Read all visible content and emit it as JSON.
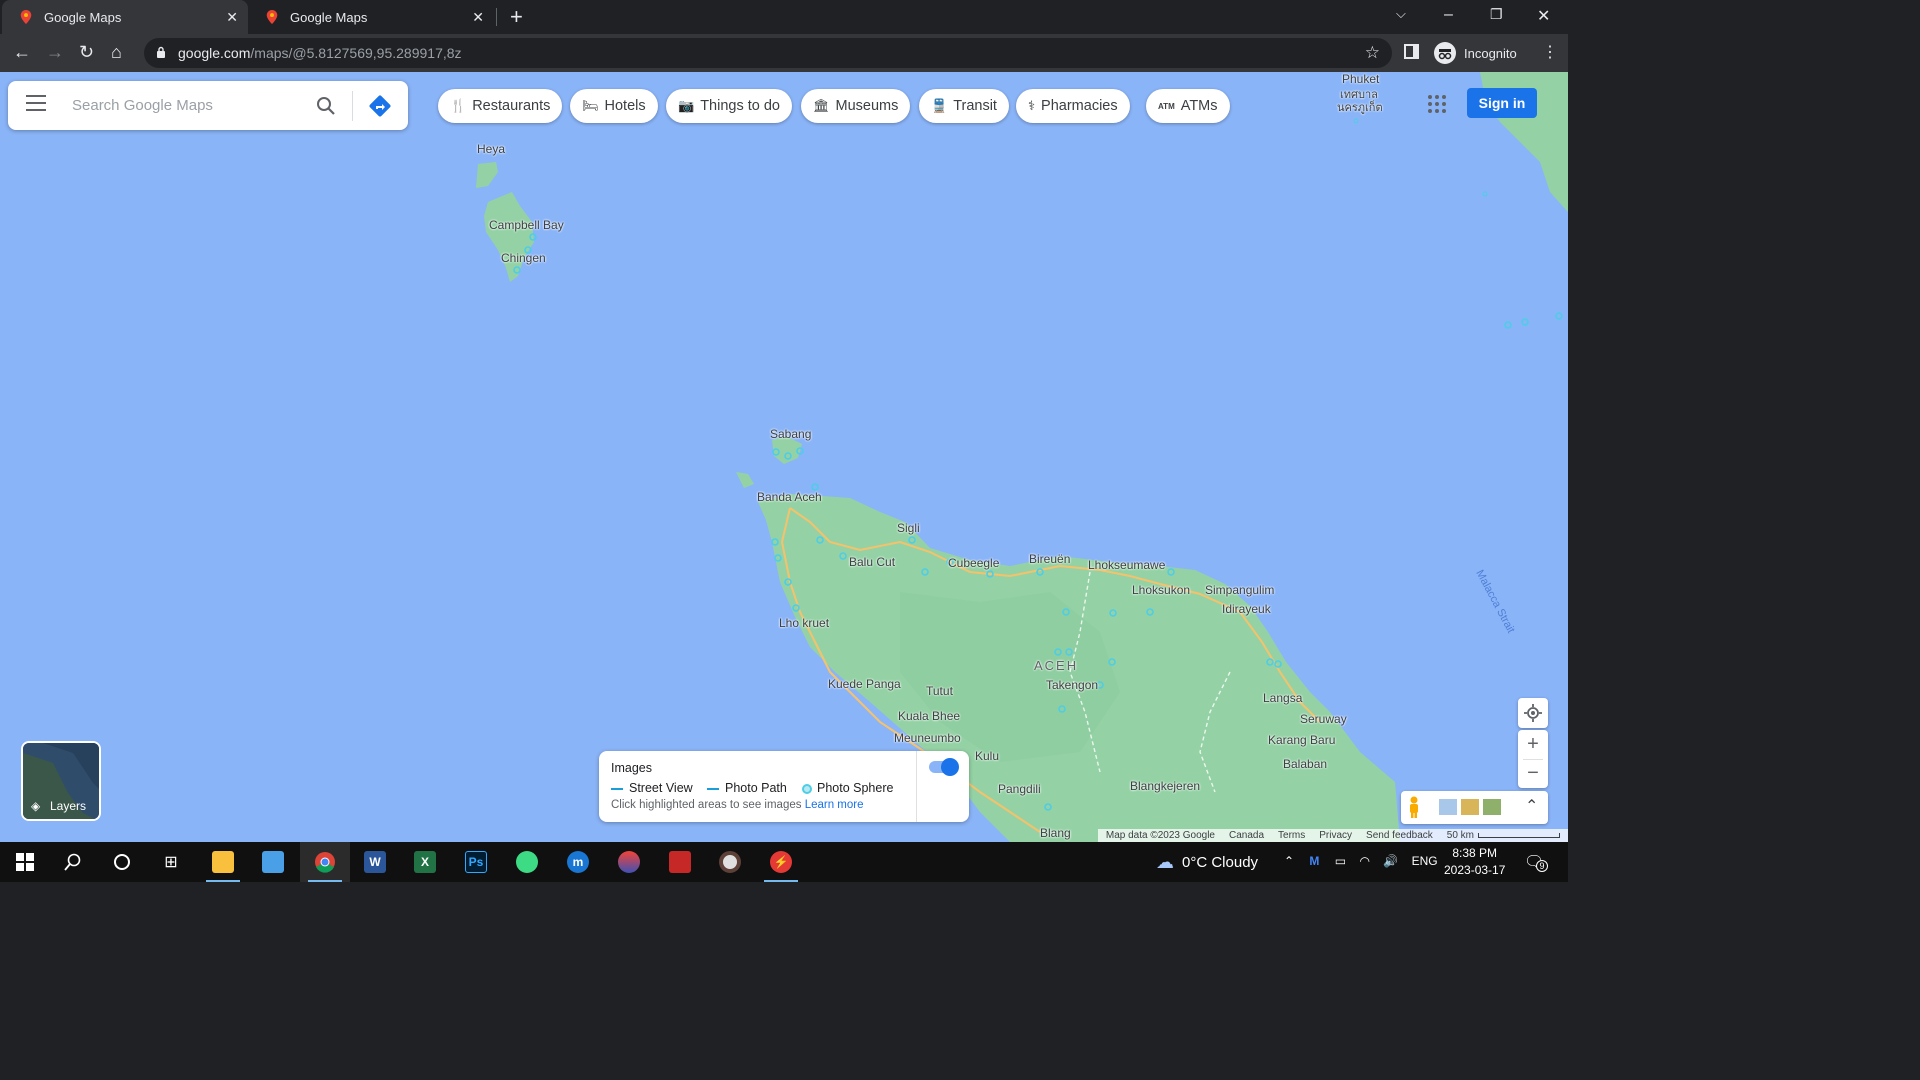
{
  "browser": {
    "tabs": [
      {
        "title": "Google Maps",
        "active": true
      },
      {
        "title": "Google Maps",
        "active": false
      }
    ],
    "new_tab": "+",
    "url_host": "google.com",
    "url_path": "/maps/@5.8127569,95.289917,8z",
    "profile_label": "Incognito"
  },
  "maps": {
    "search_placeholder": "Search Google Maps",
    "chips": [
      {
        "label": "Restaurants",
        "icon": "fork-knife-icon"
      },
      {
        "label": "Hotels",
        "icon": "bed-icon"
      },
      {
        "label": "Things to do",
        "icon": "camera-icon"
      },
      {
        "label": "Museums",
        "icon": "museum-icon"
      },
      {
        "label": "Transit",
        "icon": "train-icon"
      },
      {
        "label": "Pharmacies",
        "icon": "pharmacy-icon"
      },
      {
        "label": "ATMs",
        "icon": "atm-icon"
      }
    ],
    "sign_in": "Sign in",
    "layers_label": "Layers",
    "places": {
      "phuket": "Phuket",
      "phuket_thai_1": "เทศบาล",
      "phuket_thai_2": "นครภูเก็ต",
      "heya": "Heya",
      "campbell_bay": "Campbell Bay",
      "chingen": "Chingen",
      "sabang": "Sabang",
      "banda_aceh": "Banda Aceh",
      "sigli": "Sigli",
      "balu_cut": "Balu Cut",
      "cubeegle": "Cubeegle",
      "bireuen": "Bireuën",
      "lhokseumawe": "Lhokseumawe",
      "lhoksukon": "Lhoksukon",
      "simpangulim": "Simpangulim",
      "idirayeuk": "Idirayeuk",
      "lho_kruet": "Lho kruet",
      "aceh": "ACEH",
      "takengon": "Takengon",
      "kuede_panga": "Kuede Panga",
      "tutut": "Tutut",
      "kuala_bhee": "Kuala Bhee",
      "meuneumbo": "Meuneumbo",
      "kulu": "Kulu",
      "pangdili": "Pangdili",
      "langsa": "Langsa",
      "seruway": "Seruway",
      "karang_baru": "Karang Baru",
      "balaban": "Balaban",
      "blangkejeren": "Blangkejeren",
      "blang": "Blang",
      "malacca_strait": "Malacca Strait"
    },
    "images_panel": {
      "title": "Images",
      "street_view": "Street View",
      "photo_path": "Photo Path",
      "photo_sphere": "Photo Sphere",
      "hint": "Click highlighted areas to see images",
      "learn_more": "Learn more",
      "toggle_on": true
    },
    "footer": {
      "map_data": "Map data ©2023 Google",
      "country": "Canada",
      "terms": "Terms",
      "privacy": "Privacy",
      "feedback": "Send feedback",
      "scale": "50 km"
    },
    "colors": {
      "water": "#8ab4f8",
      "land": "#94d2a5",
      "accent": "#1a73e8"
    }
  },
  "taskbar": {
    "apps": [
      "start",
      "search",
      "cortana",
      "task-view",
      "file-explorer",
      "control-panel",
      "chrome",
      "word",
      "excel",
      "photoshop",
      "android-app",
      "mu-app",
      "color-app",
      "movie-app",
      "disk-app",
      "red-app"
    ],
    "weather": "0°C  Cloudy",
    "language": "ENG",
    "time": "8:38 PM",
    "date": "2023-03-17",
    "notifications": "9"
  }
}
